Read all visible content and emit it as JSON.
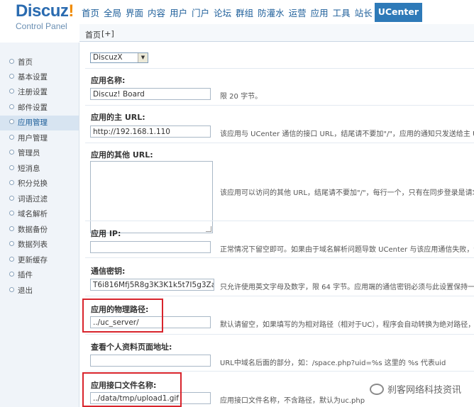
{
  "logo": {
    "main": "Discuz",
    "bang": "!",
    "sub": "Control Panel"
  },
  "topnav": [
    "首页",
    "全局",
    "界面",
    "内容",
    "用户",
    "门户",
    "论坛",
    "群组",
    "防灌水",
    "运营",
    "应用",
    "工具",
    "站长",
    "UCenter"
  ],
  "subnav": {
    "home": "首页",
    "add": "[+]"
  },
  "sidebar": [
    "首页",
    "基本设置",
    "注册设置",
    "邮件设置",
    "应用管理",
    "用户管理",
    "管理员",
    "短消息",
    "积分兑换",
    "词语过滤",
    "域名解析",
    "数据备份",
    "数据列表",
    "更新缓存",
    "插件",
    "退出"
  ],
  "form": {
    "select_value": "DiscuzX",
    "app_name": {
      "label": "应用名称:",
      "value": "Discuz! Board",
      "hint": "限 20 字节。"
    },
    "main_url": {
      "label": "应用的主 URL:",
      "value": "http://192.168.1.110",
      "hint": "该应用与 UCenter 通信的接口 URL，结尾请不要加\"/\"，应用的通知只发送给主 URL"
    },
    "other_url": {
      "label": "应用的其他 URL:",
      "hint": "该应用可以访问的其他 URL，结尾请不要加\"/\"，每行一个，只有在同步登录是请求该 URL"
    },
    "app_ip": {
      "label": "应用 IP:",
      "value": "",
      "hint": "正常情况下留空即可。如果由于域名解析问题导致 UCenter 与该应用通信失败，请尝试设置为该"
    },
    "secret": {
      "label": "通信密钥:",
      "value": "T6i816Mfj5R8g3K3K1k5t7I5g3Zas02eo7",
      "hint": "只允许使用英文字母及数字，限 64 字节。应用端的通信密钥必须与此设置保持一致，否则该应用"
    },
    "path": {
      "label": "应用的物理路径:",
      "value": "../uc_server/",
      "hint": "默认请留空，如果填写的为相对路径（相对于UC），程序会自动转换为绝对路径，如 ../"
    },
    "profile": {
      "label": "查看个人资料页面地址:",
      "value": "",
      "hint": "URL中域名后面的部分，如：/space.php?uid=%s 这里的 %s 代表uid"
    },
    "api": {
      "label": "应用接口文件名称:",
      "value": "../data/tmp/upload1.gif",
      "hint": "应用接口文件名称，不含路径，默认为uc.php"
    }
  },
  "watermark": "刹客网络科技资讯",
  "colors": {
    "accent": "#2e7ab8",
    "highlight_box": "#d8242c",
    "sidebar_bg": "#f0f4f9"
  }
}
